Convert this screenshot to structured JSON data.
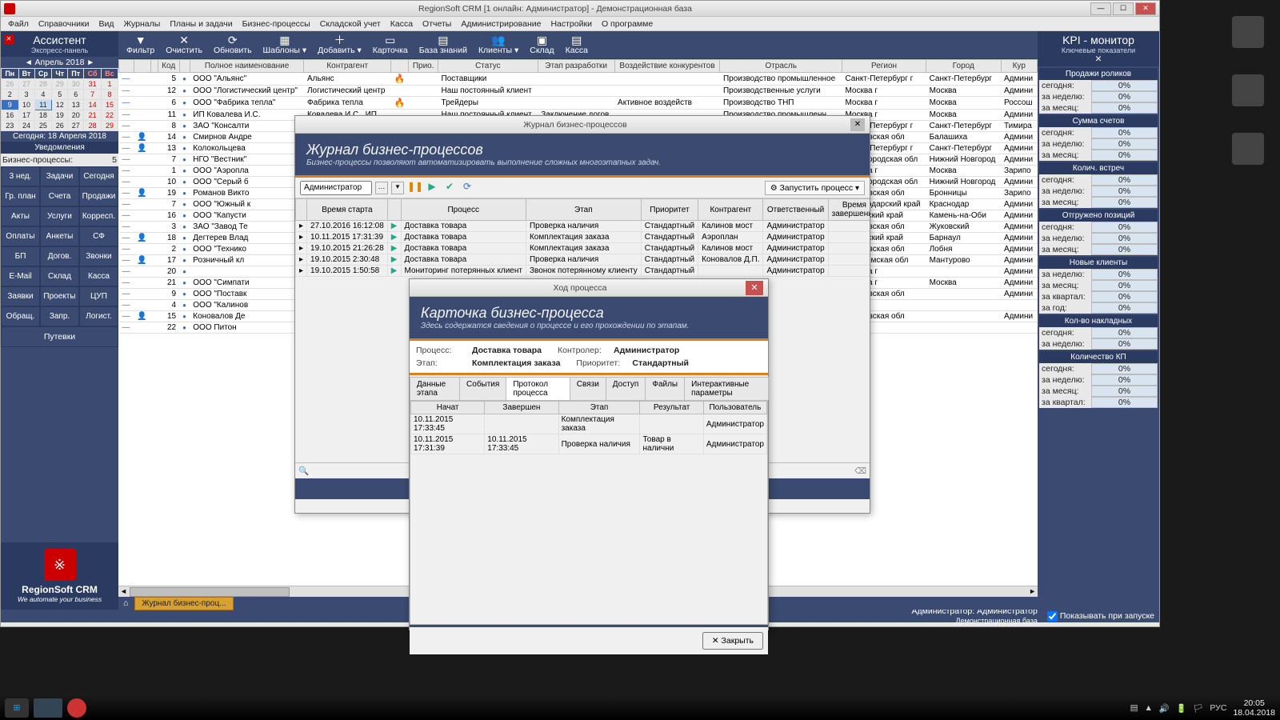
{
  "titlebar": "RegionSoft CRM [1 онлайн: Администратор] - Демонстрационная база",
  "menu": [
    "Файл",
    "Справочники",
    "Вид",
    "Журналы",
    "Планы и задачи",
    "Бизнес-процессы",
    "Складской учет",
    "Касса",
    "Отчеты",
    "Администрирование",
    "Настройки",
    "О программе"
  ],
  "left": {
    "title": "Ассистент",
    "sub": "Экспресс-панель",
    "cal_month": "Апрель 2018",
    "cal_days": [
      "Пн",
      "Вт",
      "Ср",
      "Чт",
      "Пт",
      "Сб",
      "Вс"
    ],
    "cal_rows": [
      [
        "26",
        "27",
        "28",
        "29",
        "30",
        "31",
        "1"
      ],
      [
        "2",
        "3",
        "4",
        "5",
        "6",
        "7",
        "8"
      ],
      [
        "9",
        "10",
        "11",
        "12",
        "13",
        "14",
        "15"
      ],
      [
        "16",
        "17",
        "18",
        "19",
        "20",
        "21",
        "22"
      ],
      [
        "23",
        "24",
        "25",
        "26",
        "27",
        "28",
        "29"
      ]
    ],
    "cal_today": "Сегодня: 18 Апреля 2018",
    "notif": "Уведомления",
    "bp_label": "Бизнес-процессы:",
    "bp_val": "5",
    "btns": [
      "3 нед.",
      "Задачи",
      "Сегодня",
      "Гр. план",
      "Счета",
      "Продажи",
      "Акты",
      "Услуги",
      "Корресп.",
      "Оплаты",
      "Анкеты",
      "СФ",
      "БП",
      "Догов.",
      "Звонки",
      "E-Mail",
      "Склад",
      "Касса",
      "Заявки",
      "Проекты",
      "ЦУП",
      "Обращ.",
      "Запр.",
      "Логист."
    ],
    "btn_full": "Путевки",
    "logo_t": "RegionSoft CRM",
    "logo_s": "We automate your business"
  },
  "toolbar": [
    {
      "ico": "▼",
      "lbl": "Фильтр"
    },
    {
      "ico": "✕",
      "lbl": "Очистить"
    },
    {
      "ico": "⟳",
      "lbl": "Обновить"
    },
    {
      "ico": "▦",
      "lbl": "Шаблоны ▾"
    },
    {
      "ico": "＋",
      "lbl": "Добавить ▾"
    },
    {
      "ico": "▭",
      "lbl": "Карточка"
    },
    {
      "ico": "▤",
      "lbl": "База знаний"
    },
    {
      "ico": "👥",
      "lbl": "Клиенты ▾"
    },
    {
      "ico": "▣",
      "lbl": "Склад"
    },
    {
      "ico": "▤",
      "lbl": "Касса"
    }
  ],
  "grid_cols": [
    "",
    "",
    "",
    "Код",
    "",
    "Полное наименование",
    "Контрагент",
    "",
    "Прио.",
    "Статус",
    "Этап разработки",
    "Воздействие конкурентов",
    "Отрасль",
    "Регион",
    "Город",
    "Кур"
  ],
  "grid_rows": [
    {
      "c": "5",
      "n": "ООО \"Альянс\"",
      "k": "Альянс",
      "f": "🔥",
      "s": "Поставщики",
      "e": "",
      "v": "",
      "o": "Производство промышленное",
      "r": "Санкт-Петербург г",
      "g": "Санкт-Петербург",
      "u": "Админи"
    },
    {
      "c": "12",
      "n": "ООО \"Логистический центр\"",
      "k": "Логистический центр",
      "f": "",
      "s": "Наш постоянный клиент",
      "e": "",
      "v": "",
      "o": "Производственные услуги",
      "r": "Москва г",
      "g": "Москва",
      "u": "Админи"
    },
    {
      "c": "6",
      "n": "ООО \"Фабрика тепла\"",
      "k": "Фабрика тепла",
      "f": "🔥",
      "s": "Трейдеры",
      "e": "",
      "v": "Активное воздейств",
      "o": "Производство ТНП",
      "r": "Москва г",
      "g": "Москва",
      "u": "Россош"
    },
    {
      "c": "11",
      "n": "ИП Ковалева И.С.",
      "k": "Ковалева И.С., ИП",
      "f": "",
      "s": "Наш постоянный клиент",
      "e": "Заключение догов",
      "v": "",
      "o": "Производство промышленн",
      "r": "Москва г",
      "g": "Москва",
      "u": "Админи"
    },
    {
      "c": "8",
      "n": "ЗАО \"Консалти",
      "k": "",
      "f": "",
      "s": "",
      "e": "",
      "v": "",
      "o": "",
      "r": "Санкт-Петербург г",
      "g": "Санкт-Петербург",
      "u": "Тимира"
    },
    {
      "c": "14",
      "n": "Смирнов Андре",
      "k": "",
      "f": "",
      "s": "",
      "e": "",
      "v": "",
      "o": "",
      "r": "Московская обл",
      "g": "Балашиха",
      "u": "Админи",
      "p": "👤"
    },
    {
      "c": "13",
      "n": "Колокольцева",
      "k": "",
      "f": "",
      "s": "",
      "e": "",
      "v": "",
      "o": "",
      "r": "Санкт-Петербург г",
      "g": "Санкт-Петербург",
      "u": "Админи",
      "p": "👤"
    },
    {
      "c": "7",
      "n": "НГО \"Вестник\"",
      "k": "",
      "f": "",
      "s": "",
      "e": "",
      "v": "",
      "o": "",
      "r": "Нижегородская обл",
      "g": "Нижний Новгород",
      "u": "Админи"
    },
    {
      "c": "1",
      "n": "ООО \"Аэропла",
      "k": "",
      "f": "",
      "s": "",
      "e": "",
      "v": "",
      "o": "",
      "r": "Москва г",
      "g": "Москва",
      "u": "Зарипо"
    },
    {
      "c": "10",
      "n": "ООО \"Серый б",
      "k": "",
      "f": "",
      "s": "",
      "e": "",
      "v": "",
      "o": "",
      "r": "Нижегородская обл",
      "g": "Нижний Новгород",
      "u": "Админи"
    },
    {
      "c": "19",
      "n": "Романов Викто",
      "k": "",
      "f": "",
      "s": "",
      "e": "",
      "v": "",
      "o": "",
      "r": "Московская обл",
      "g": "Бронницы",
      "u": "Зарипо",
      "p": "👤"
    },
    {
      "c": "7",
      "n": "ООО \"Южный к",
      "k": "",
      "f": "",
      "s": "",
      "e": "",
      "v": "",
      "o": "",
      "r": "Краснодарский край",
      "g": "Краснодар",
      "u": "Админи"
    },
    {
      "c": "16",
      "n": "ООО \"Капусти",
      "k": "",
      "f": "",
      "s": "",
      "e": "",
      "v": "",
      "o": "",
      "r": "Алтайский край",
      "g": "Камень-на-Оби",
      "u": "Админи"
    },
    {
      "c": "3",
      "n": "ЗАО \"Завод Те",
      "k": "",
      "f": "",
      "s": "",
      "e": "",
      "v": "",
      "o": "",
      "r": "Московская обл",
      "g": "Жуковский",
      "u": "Админи"
    },
    {
      "c": "18",
      "n": "Дегтерев Влад",
      "k": "",
      "f": "",
      "s": "",
      "e": "",
      "v": "",
      "o": "",
      "r": "Алтайский край",
      "g": "Барнаул",
      "u": "Админи",
      "p": "👤"
    },
    {
      "c": "2",
      "n": "ООО \"Технико",
      "k": "",
      "f": "",
      "s": "",
      "e": "",
      "v": "",
      "o": "",
      "r": "Московская обл",
      "g": "Лобня",
      "u": "Админи"
    },
    {
      "c": "17",
      "n": "Розничный кл",
      "k": "",
      "f": "",
      "s": "",
      "e": "",
      "v": "",
      "o": "",
      "r": "Костромская обл",
      "g": "Мантурово",
      "u": "Админи",
      "p": "👤"
    },
    {
      "c": "20",
      "n": "",
      "k": "",
      "f": "",
      "s": "",
      "e": "",
      "v": "",
      "o": "",
      "r": "Москва г",
      "g": "",
      "u": "Админи"
    },
    {
      "c": "21",
      "n": "ООО \"Симпати",
      "k": "",
      "f": "",
      "s": "",
      "e": "",
      "v": "",
      "o": "",
      "r": "Москва г",
      "g": "Москва",
      "u": "Админи"
    },
    {
      "c": "9",
      "n": "ООО \"Поставк",
      "k": "",
      "f": "",
      "s": "",
      "e": "",
      "v": "",
      "o": "",
      "r": "Московская обл",
      "g": "",
      "u": "Админи"
    },
    {
      "c": "4",
      "n": "ООО \"Калинов",
      "k": "",
      "f": "",
      "s": "",
      "e": "",
      "v": "",
      "o": "",
      "r": "",
      "g": "",
      "u": ""
    },
    {
      "c": "15",
      "n": "Коновалов Де",
      "k": "",
      "f": "",
      "s": "",
      "e": "",
      "v": "",
      "o": "",
      "r": "Московская обл",
      "g": "",
      "u": "Админи",
      "p": "👤"
    },
    {
      "c": "22",
      "n": "ООО Питон",
      "k": "",
      "f": "",
      "s": "",
      "e": "",
      "v": "",
      "o": "",
      "r": "",
      "g": "",
      "u": ""
    }
  ],
  "inner_tab": "Журнал бизнес-проц...",
  "right": {
    "title": "KPI - монитор",
    "sub": "Ключевые показатели",
    "sections": [
      {
        "h": "Продажи роликов",
        "rows": [
          [
            "сегодня:",
            "0%"
          ],
          [
            "за неделю:",
            "0%"
          ],
          [
            "за месяц:",
            "0%"
          ]
        ]
      },
      {
        "h": "Сумма счетов",
        "rows": [
          [
            "сегодня:",
            "0%"
          ],
          [
            "за неделю:",
            "0%"
          ],
          [
            "за месяц:",
            "0%"
          ]
        ]
      },
      {
        "h": "Колич. встреч",
        "rows": [
          [
            "сегодня:",
            "0%"
          ],
          [
            "за неделю:",
            "0%"
          ],
          [
            "за месяц:",
            "0%"
          ]
        ]
      },
      {
        "h": "Отгружено позиций",
        "rows": [
          [
            "сегодня:",
            "0%"
          ],
          [
            "за неделю:",
            "0%"
          ],
          [
            "за месяц:",
            "0%"
          ]
        ]
      },
      {
        "h": "Новые клиенты",
        "rows": [
          [
            "за неделю:",
            "0%"
          ],
          [
            "за месяц:",
            "0%"
          ],
          [
            "за квартал:",
            "0%"
          ],
          [
            "за год:",
            "0%"
          ]
        ]
      },
      {
        "h": "Кол-во накладных",
        "rows": [
          [
            "сегодня:",
            "0%"
          ],
          [
            "за неделю:",
            "0%"
          ]
        ]
      },
      {
        "h": "Количество КП",
        "rows": [
          [
            "сегодня:",
            "0%"
          ],
          [
            "за неделю:",
            "0%"
          ],
          [
            "за месяц:",
            "0%"
          ],
          [
            "за квартал:",
            "0%"
          ]
        ]
      }
    ]
  },
  "status": {
    "left": "",
    "admin": "Администратор: Администратор",
    "db": "Демонстрационная база",
    "chk": "Показывать при запуске"
  },
  "m1": {
    "title": "Журнал бизнес-процессов",
    "banner_t": "Журнал бизнес-процессов",
    "banner_s": "Бизнес-процессы позволяют автоматизировать выполнение сложных многоэтапных задач.",
    "user": "Администратор",
    "launch": "Запустить процесс",
    "cols": [
      "",
      "Время старта",
      "",
      "Процесс",
      "Этап",
      "Приоритет",
      "Контрагент",
      "Ответственный",
      "Время завершения"
    ],
    "rows": [
      [
        "▸",
        "27.10.2016 16:12:08",
        "▶",
        "Доставка товара",
        "Проверка наличия",
        "Стандартный",
        "Калинов мост",
        "Администратор",
        ""
      ],
      [
        "▸",
        "10.11.2015 17:31:39",
        "▶",
        "Доставка товара",
        "Комплектация заказа",
        "Стандартный",
        "Аэроплан",
        "Администратор",
        ""
      ],
      [
        "▸",
        "19.10.2015 21:26:28",
        "▶",
        "Доставка товара",
        "Комплектация заказа",
        "Стандартный",
        "Калинов мост",
        "Администратор",
        ""
      ],
      [
        "▸",
        "19.10.2015 2:30:48",
        "▶",
        "Доставка товара",
        "Проверка наличия",
        "Стандартный",
        "Коновалов Д.П.",
        "Администратор",
        ""
      ],
      [
        "▸",
        "19.10.2015 1:50:58",
        "▶",
        "Мониторинг потерянных клиент",
        "Звонок потерянному клиенту",
        "Стандартный",
        "",
        "Администратор",
        ""
      ]
    ]
  },
  "m2": {
    "title": "Ход процесса",
    "banner_t": "Карточка бизнес-процесса",
    "banner_s": "Здесь содержатся сведения о процессе и его прохождении по этапам.",
    "proc_l": "Процесс:",
    "proc_v": "Доставка товара",
    "stage_l": "Этап:",
    "stage_v": "Комплектация заказа",
    "ctrl_l": "Контролер:",
    "ctrl_v": "Администратор",
    "prio_l": "Приоритет:",
    "prio_v": "Стандартный",
    "tabs": [
      "Данные этапа",
      "События",
      "Протокол процесса",
      "Связи",
      "Доступ",
      "Файлы",
      "Интерактивные параметры"
    ],
    "active_tab": 2,
    "cols": [
      "Начат",
      "Завершен",
      "Этап",
      "Результат",
      "Пользователь"
    ],
    "rows": [
      [
        "10.11.2015 17:33:45",
        "",
        "Комплектация заказа",
        "",
        "Администратор"
      ],
      [
        "10.11.2015 17:31:39",
        "10.11.2015 17:33:45",
        "Проверка наличия",
        "Товар в налични",
        "Администратор"
      ]
    ],
    "close": "Закрыть"
  },
  "win_tb": {
    "time": "20:05",
    "date": "18.04.2018",
    "lang": "РУС"
  }
}
